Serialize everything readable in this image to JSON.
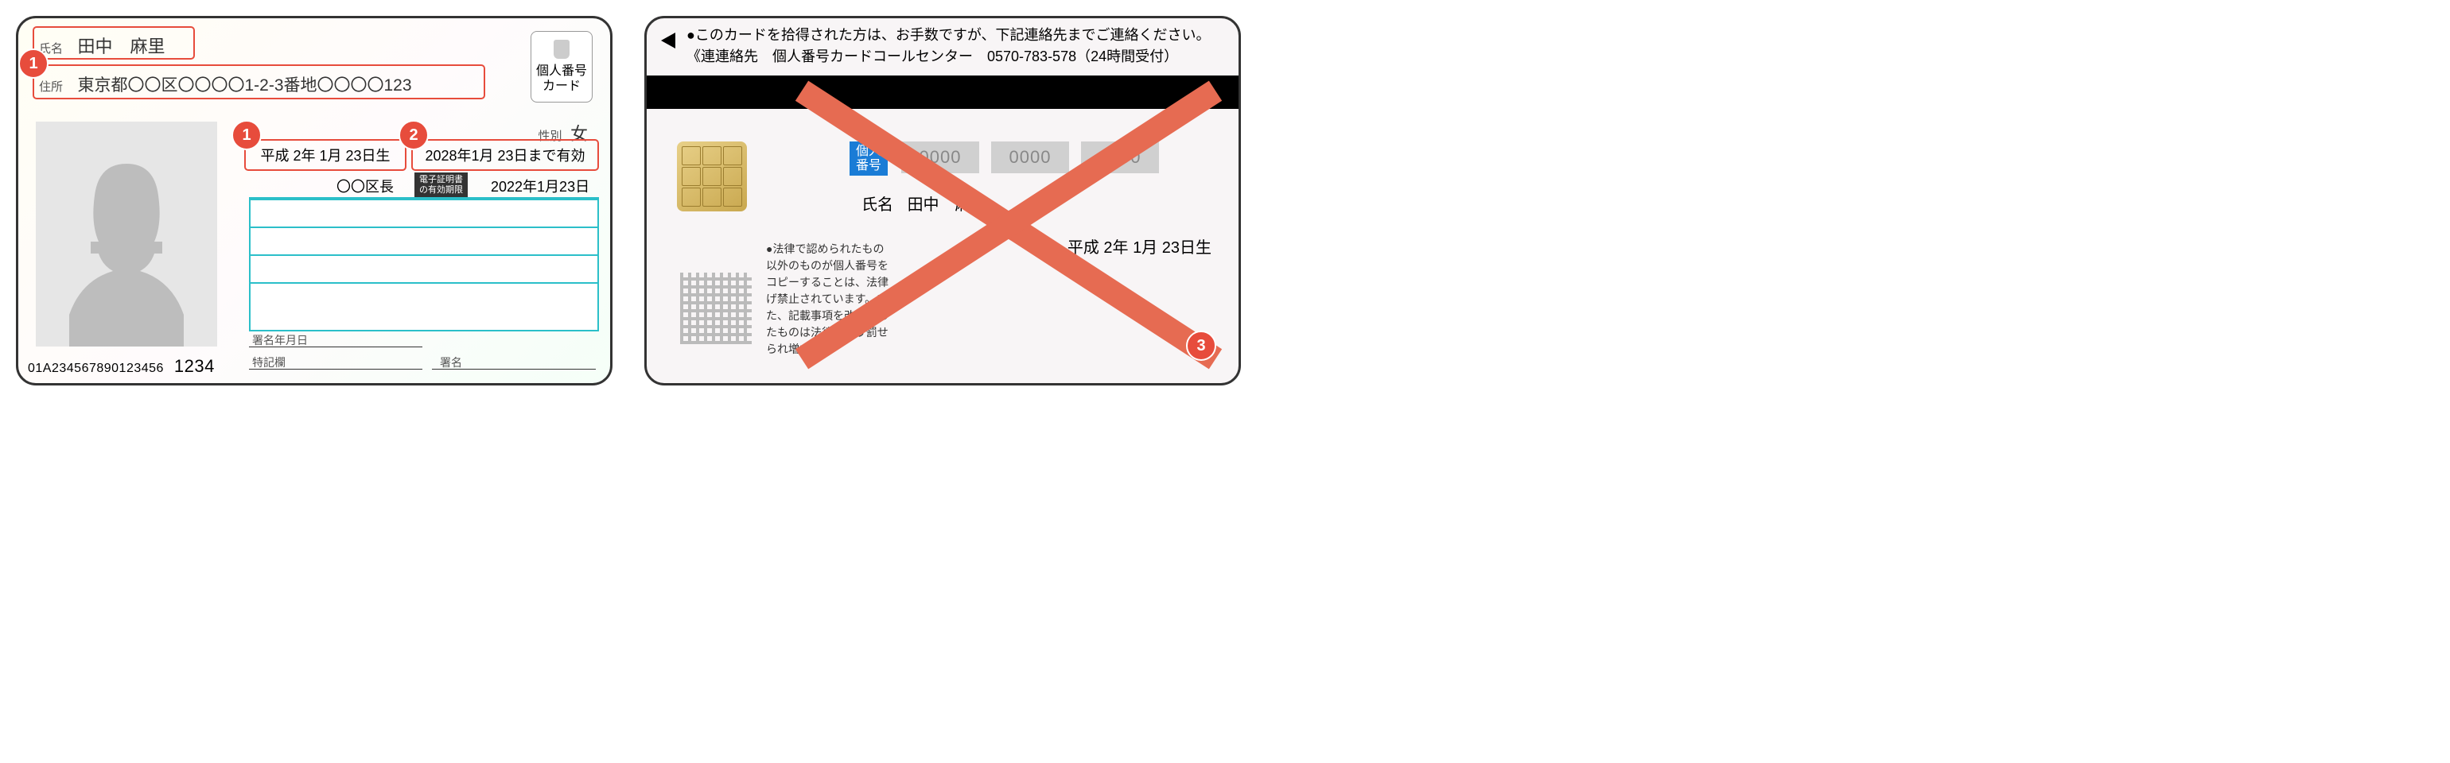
{
  "front": {
    "name_label": "氏名",
    "name_value": "田中　麻里",
    "addr_label": "住所",
    "addr_value": "東京都〇〇区〇〇〇〇1-2-3番地〇〇〇〇123",
    "card_type": "個人番号\nカード",
    "sex_label": "性別",
    "sex_value": "女",
    "dob": "平成 2年 1月 23日生",
    "expiry": "2028年1月 23日まで有効",
    "issuer": "〇〇区長",
    "cert_label": "電子証明書\nの有効期限",
    "cert_date": "2022年1月23日",
    "sig_date_label": "署名年月日",
    "remarks_label": "特記欄",
    "sig_label": "署名",
    "serial": "01A234567890123456",
    "pin": "1234"
  },
  "back": {
    "notice1": "●このカードを拾得された方は、お手数ですが、下記連絡先までご連絡ください。",
    "notice2": "《連連絡先　個人番号カードコールセンター　0570-783-578（24時間受付）",
    "num_label": "個人\n番号",
    "num_masked": "0000",
    "name_label": "氏名",
    "name_value": "田中　麻里",
    "dob": "平成 2年 1月 23日生",
    "legal": "●法律で認められたもの以外のものが個人番号をコピーすることは、法律げ禁止されています。また、記載事項を改ざんしたものは法律により罰せられ増す"
  },
  "callouts": {
    "a": "1",
    "b": "1",
    "c": "2",
    "d": "3"
  }
}
